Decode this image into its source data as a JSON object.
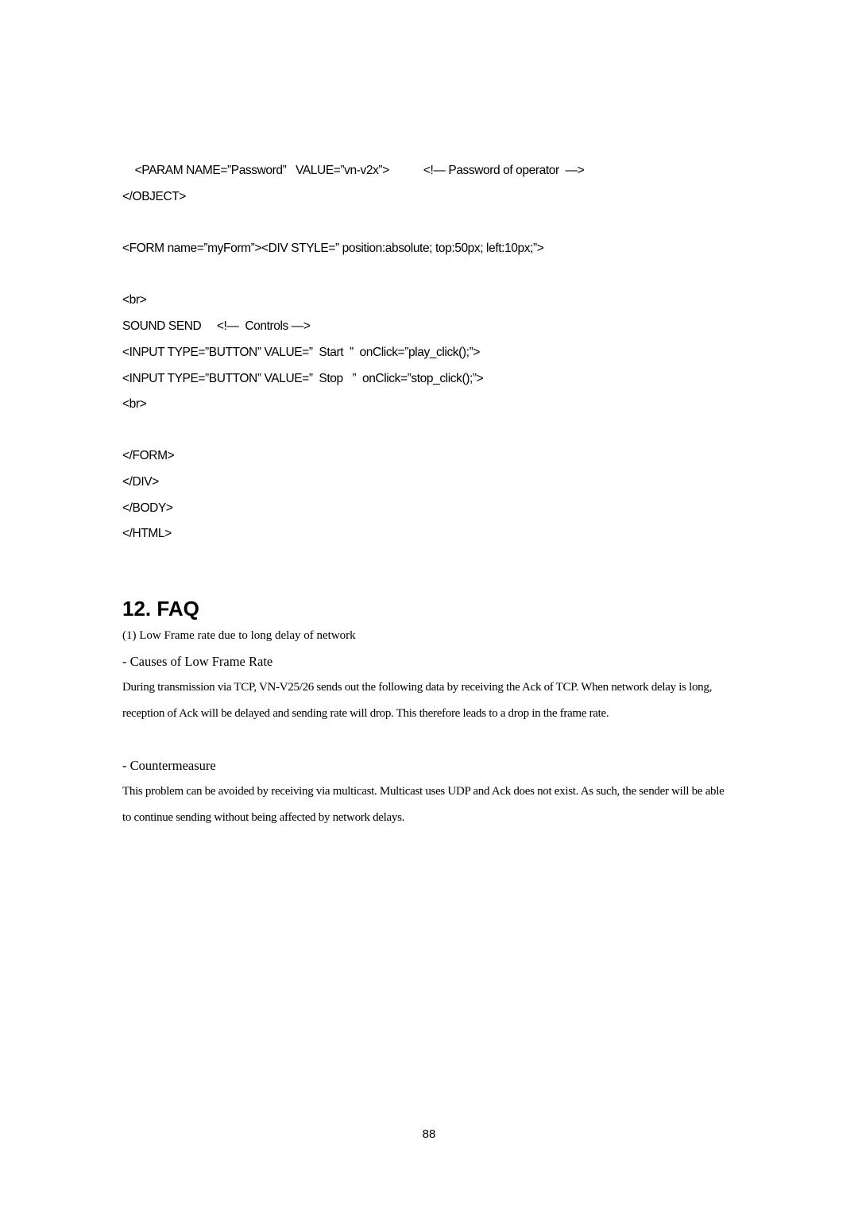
{
  "code_lines": [
    "    <PARAM NAME=”Password”   VALUE=”vn-v2x”>           <!— Password of operator  —>",
    "</OBJECT>",
    "<FORM name=”myForm”><DIV STYLE=” position:absolute; top:50px; left:10px;”>",
    "<br>",
    "SOUND SEND     <!—  Controls —>",
    "<INPUT TYPE=”BUTTON” VALUE=”  Start  ”  onClick=”play_click();”>",
    "<INPUT TYPE=”BUTTON” VALUE=”  Stop   ”  onClick=”stop_click();”>",
    "<br>",
    "</FORM>",
    "</DIV>",
    "</BODY>",
    "</HTML>"
  ],
  "section": {
    "title": "12. FAQ",
    "item_title": "(1) Low Frame rate due to long delay of network",
    "causes_heading": "- Causes of Low Frame Rate",
    "causes_text": "During transmission via TCP, VN-V25/26 sends out the following data by receiving the Ack of TCP. When network delay is long, reception of Ack will be delayed and sending rate will drop. This therefore leads to a drop in the frame rate.",
    "countermeasure_heading": "- Countermeasure",
    "countermeasure_text": "This problem can be avoided by receiving via multicast. Multicast uses UDP and Ack does not exist. As such, the sender will be able to continue sending without being affected by network delays."
  },
  "page_number": "88"
}
